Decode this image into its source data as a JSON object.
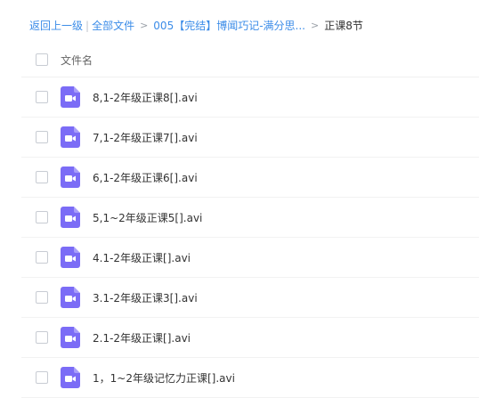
{
  "breadcrumb": {
    "back": "返回上一级",
    "separator": "|",
    "all_files": "全部文件",
    "folder": "005【完结】博闻巧记-满分思...",
    "current": "正课8节"
  },
  "list": {
    "header_label": "文件名",
    "icon": "video-file-icon",
    "icon_color": "#7b6cf6",
    "files": [
      "8,1-2年级正课8[].avi",
      "7,1-2年级正课7[].avi",
      "6,1-2年级正课6[].avi",
      "5,1~2年级正课5[].avi",
      "4.1-2年级正课[].avi",
      "3.1-2年级正课3[].avi",
      "2.1-2年级正课[].avi",
      "1，1~2年级记忆力正课[].avi"
    ]
  }
}
